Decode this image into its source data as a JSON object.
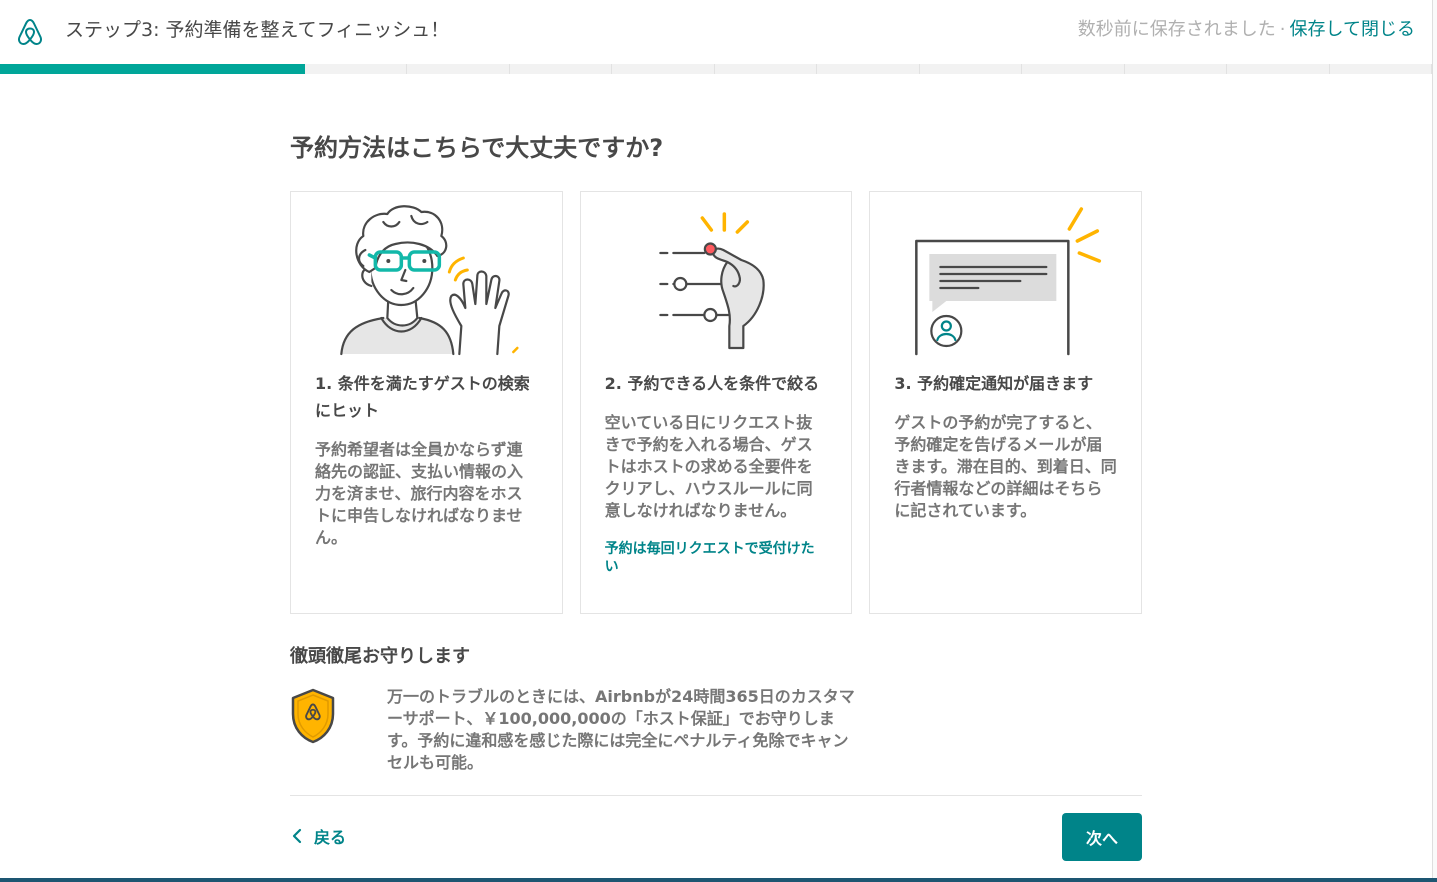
{
  "header": {
    "logo_icon": "airbnb-logo-icon",
    "step_title": "ステップ3: 予約準備を整えてフィニッシュ！",
    "saved_status": "数秒前に保存されました",
    "separator": "·",
    "save_and_close": "保存して閉じる"
  },
  "progress": {
    "completed_segments": 3,
    "total_segments": 14
  },
  "main": {
    "heading": "予約方法はこちらで大丈夫ですか?",
    "cards": [
      {
        "illustration": "waving-guest-illustration",
        "title": "1. 条件を満たすゲストの検索にヒット",
        "body": "予約希望者は全員かならず連絡先の認証、支払い情報の入力を済ませ、旅行内容をホストに申告しなければなりません。"
      },
      {
        "illustration": "filter-sliders-illustration",
        "title": "2. 予約できる人を条件で絞る",
        "body": "空いている日にリクエスト抜きで予約を入れる場合、ゲストはホストの求める全要件をクリアし、ハウスルールに同意しなければなりません。",
        "link": "予約は毎回リクエストで受付けたい"
      },
      {
        "illustration": "confirmation-message-illustration",
        "title": "3. 予約確定通知が届きます",
        "body": "ゲストの予約が完了すると、予約確定を告げるメールが届きます。滞在目的、到着日、同行者情報などの詳細はそちらに記されています。"
      }
    ],
    "protection": {
      "title": "徹頭徹尾お守りします",
      "icon": "shield-icon",
      "text": "万一のトラブルのときには、Airbnbが24時間365日のカスタマーサポート、￥100,000,000の「ホスト保証」でお守りします。予約に違和感を感じた際には完全にペナルティ免除でキャンセルも可能。"
    }
  },
  "footer": {
    "back_icon": "chevron-left-icon",
    "back_label": "戻る",
    "next_label": "次へ"
  },
  "colors": {
    "teal": "#008489",
    "progress": "#00a699",
    "text": "#484848",
    "muted": "#767676",
    "shield": "#ffb400",
    "bottom_bar": "#1d5672"
  }
}
